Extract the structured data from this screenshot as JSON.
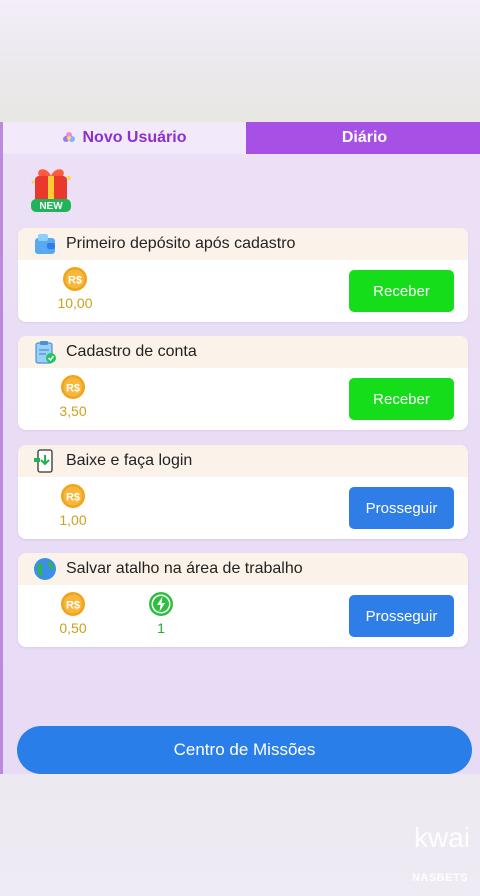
{
  "tabs": {
    "new_user": "Novo Usuário",
    "daily": "Diário"
  },
  "badge": {
    "label": "NEW"
  },
  "tasks": [
    {
      "title": "Primeiro depósito após cadastro",
      "coin_label": "R$",
      "reward": "10,00",
      "button": "Receber",
      "button_color": "#16dd1a",
      "icon": "wallet-icon"
    },
    {
      "title": "Cadastro de conta",
      "coin_label": "R$",
      "reward": "3,50",
      "button": "Receber",
      "button_color": "#16dd1a",
      "icon": "clipboard-check-icon"
    },
    {
      "title": "Baixe e faça login",
      "coin_label": "R$",
      "reward": "1,00",
      "button": "Prosseguir",
      "button_color": "#2f7ee8",
      "icon": "phone-download-icon"
    },
    {
      "title": "Salvar atalho na área de trabalho",
      "coin_label": "R$",
      "reward": "0,50",
      "energy": "1",
      "button": "Prosseguir",
      "button_color": "#2f7ee8",
      "icon": "globe-icon"
    }
  ],
  "mission_center": "Centro de Missões",
  "watermark": {
    "logo": "kwai",
    "handle": "NASBETS"
  },
  "colors": {
    "accent_purple": "#a650e6",
    "green_button": "#16dd1a",
    "blue_button": "#2f7ee8",
    "coin": "#f2a31b"
  }
}
